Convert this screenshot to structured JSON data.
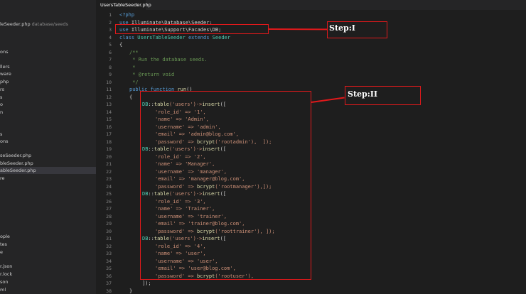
{
  "sidebar": {
    "open_file": {
      "name": "leSeeder.php",
      "path": "database/seeds"
    },
    "items": [
      "ons",
      "llers",
      "ware",
      "php",
      "rs",
      "s",
      "o",
      "n",
      "s",
      "ons",
      "seSeeder.php",
      "bleSeeder.php",
      "ableSeeder.php",
      "re",
      "ople",
      "tes",
      "e",
      "r.json",
      "r.lock",
      "son",
      "ml"
    ]
  },
  "tab": {
    "label": "UsersTableSeeder.php"
  },
  "line_numbers": [
    "1",
    "2",
    "3",
    "4",
    "5",
    "6",
    "7",
    "8",
    "9",
    "10",
    "11",
    "12",
    "13",
    "14",
    "15",
    "16",
    "17",
    "18",
    "19",
    "20",
    "21",
    "22",
    "23",
    "24",
    "25",
    "26",
    "27",
    "28",
    "29",
    "30",
    "31",
    "32",
    "33",
    "34",
    "35",
    "36",
    "37",
    "38"
  ],
  "code": {
    "l1": "<?php",
    "l2a": "use ",
    "l2b": "Illuminate\\Database\\Seeder",
    "l2c": ";",
    "l3a": "use ",
    "l3b": "Illuminate\\Support\\Facades\\DB",
    "l3c": ";",
    "l4a": "class ",
    "l4b": "UsersTableSeeder",
    "l4c": " extends ",
    "l4d": "Seeder",
    "l5": "{",
    "l6": "/**",
    "l7": " * Run the database seeds.",
    "l8": " *",
    "l9": " * @return void",
    "l10": " */",
    "l11a": "public ",
    "l11b": "function ",
    "l11c": "run",
    "l11d": "()",
    "l12": "{",
    "insert_a": "DB",
    "insert_b": "::",
    "insert_c": "table",
    "insert_d": "('users')->",
    "insert_e": "insert",
    "insert_f": "([",
    "l14": "'role_id' => '1',",
    "l15": "'name' => 'Admin',",
    "l16": "'username' => 'admin',",
    "l17": "'email' => 'admin@blog.com',",
    "l18a": "'password' => ",
    "l18b": "bcrypt",
    "l18c": "('rootadmin'),  ]);",
    "l20": "'role_id' => '2',",
    "l21": "'name' => 'Manager',",
    "l22": "'username' => 'manager',",
    "l23": "'email' => 'manager@blog.com',",
    "l24a": "'password' => ",
    "l24b": "bcrypt",
    "l24c": "('rootmanager'),]);",
    "l26": "'role_id' => '3',",
    "l27": "'name' => 'Trainer',",
    "l28": "'username' => 'trainer',",
    "l29": "'email' => 'trainer@blog.com',",
    "l30a": "'password' => ",
    "l30b": "bcrypt",
    "l30c": "('roottrainer'), ]);",
    "l32": "'role_id' => '4',",
    "l33": "'name' => 'user',",
    "l34": "'username' => 'user',",
    "l35": "'email' => 'user@blog.com',",
    "l36a": "'password' => ",
    "l36b": "bcrypt",
    "l36c": "('rootuser'),",
    "l37": "]);",
    "l38": "}",
    "l39": "}"
  },
  "annotations": {
    "step1": "Step:I",
    "step2": "Step:II",
    "color": "#e0191b"
  }
}
